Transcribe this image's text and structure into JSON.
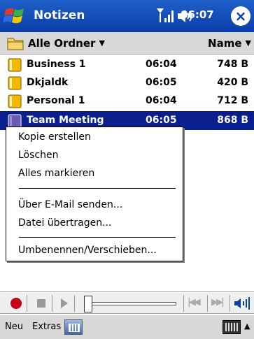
{
  "titlebar": {
    "app_title": "Notizen",
    "clock": "06:07",
    "close_label": "×"
  },
  "folderbar": {
    "folder_label": "Alle Ordner",
    "sort_label": "Name"
  },
  "notes": [
    {
      "name": "Business 1",
      "time": "06:04",
      "size": "748 B",
      "selected": false
    },
    {
      "name": "Dkjaldk",
      "time": "06:05",
      "size": "420 B",
      "selected": false
    },
    {
      "name": "Personal 1",
      "time": "06:04",
      "size": "712 B",
      "selected": false
    },
    {
      "name": "Team Meeting",
      "time": "06:05",
      "size": "868 B",
      "selected": true
    }
  ],
  "context_menu": {
    "items": [
      "Kopie erstellen",
      "Löschen",
      "Alles markieren",
      "Über E-Mail senden...",
      "Datei übertragen...",
      "Umbenennen/Verschieben..."
    ]
  },
  "recorder": {
    "prev_label": "|◀◀",
    "next_label": "▶▶|"
  },
  "menubar": {
    "new_label": "Neu",
    "extras_label": "Extras",
    "sip_arrow": "▲"
  },
  "colors": {
    "titlebar": "#0a3ea8",
    "selection": "#0a1e8e",
    "record": "#c8001a",
    "folder_yellow": "#f5b800"
  }
}
